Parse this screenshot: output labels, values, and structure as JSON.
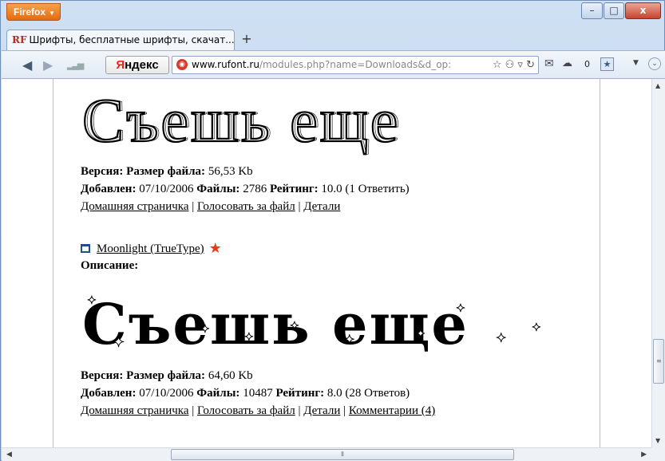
{
  "browser": {
    "menu_label": "Firefox",
    "window_controls": {
      "minimize": "–",
      "maximize": "□",
      "close": "x"
    },
    "tab": {
      "favicon_text": "RF",
      "title": "Шрифты, бесплатные шрифты, скачат..."
    },
    "new_tab": "+",
    "yandex": {
      "first": "Я",
      "rest": "ндекс"
    },
    "url": {
      "domain": "www.rufont.ru",
      "path": "/modules.php?name=Downloads&d_op:"
    },
    "mail_count": "0",
    "colors": {
      "firefox_orange": "#e8771f",
      "close_red": "#c7432e",
      "star": "#e43b1c"
    }
  },
  "entries": [
    {
      "preview_text": "Съешь еще",
      "meta1": {
        "version_label": "Версия:",
        "size_label": "Размер файла:",
        "size_value": "56,53 Kb"
      },
      "meta2": {
        "added_label": "Добавлен:",
        "added_value": "07/10/2006",
        "files_label": "Файлы:",
        "files_value": "2786",
        "rating_label": "Рейтинг:",
        "rating_value": "10.0 (1 Ответить)"
      },
      "links": {
        "home": "Домашняя страничка",
        "vote": "Голосовать за файл",
        "details": "Детали"
      }
    },
    {
      "title": "Moonlight (TrueType)",
      "desc_label": "Описание:",
      "preview_text": "Съешь еще",
      "meta1": {
        "version_label": "Версия:",
        "size_label": "Размер файла:",
        "size_value": "64,60 Kb"
      },
      "meta2": {
        "added_label": "Добавлен:",
        "added_value": "07/10/2006",
        "files_label": "Файлы:",
        "files_value": "10487",
        "rating_label": "Рейтинг:",
        "rating_value": "8.0 (28 Ответов)"
      },
      "links": {
        "home": "Домашняя страничка",
        "vote": "Голосовать за файл",
        "details": "Детали",
        "comments": "Комментарии (4)"
      }
    }
  ],
  "separators": {
    "pipe": " | "
  }
}
